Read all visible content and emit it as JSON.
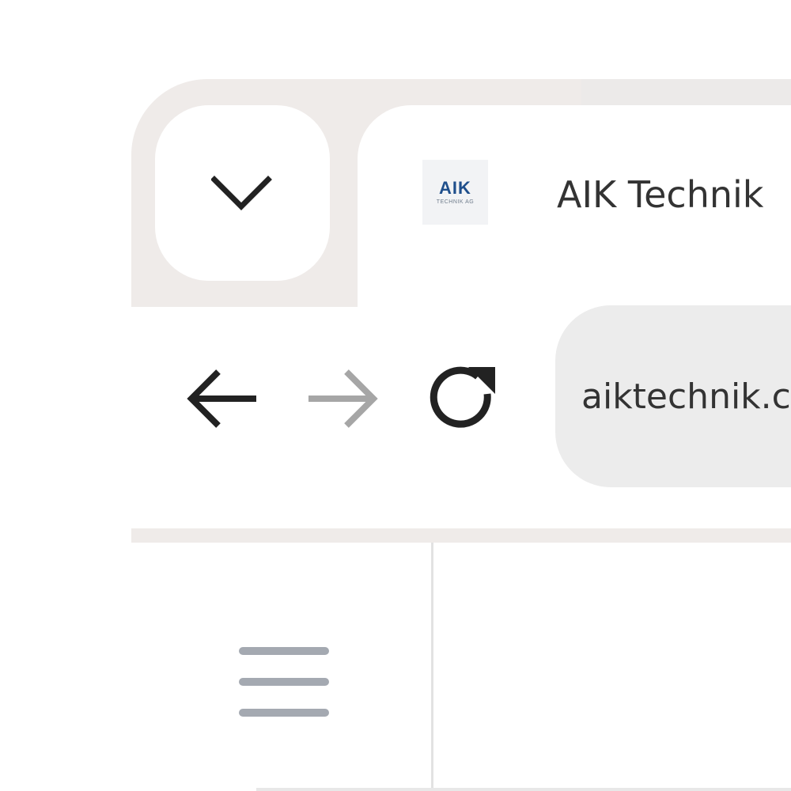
{
  "tab": {
    "title": "AIK Technik",
    "favicon": {
      "logo_text": "AIK",
      "sub_text": "TECHNIK AG",
      "brand_color": "#1f4f8c"
    },
    "dropdown_icon": "chevron-down-icon"
  },
  "toolbar": {
    "back_icon": "arrow-left-icon",
    "forward_icon": "arrow-right-icon",
    "reload_icon": "reload-icon",
    "back_enabled": true,
    "forward_enabled": false
  },
  "omnibox": {
    "url": "aiktechnik.c"
  },
  "side_panel": {
    "menu_icon": "hamburger-menu-icon"
  },
  "colors": {
    "tab_strip": "#efebe9",
    "omnibox_bg": "#ececec",
    "icon_dark": "#222222",
    "icon_disabled": "#a6a6a6",
    "menu_icon": "#a4a9b1"
  }
}
